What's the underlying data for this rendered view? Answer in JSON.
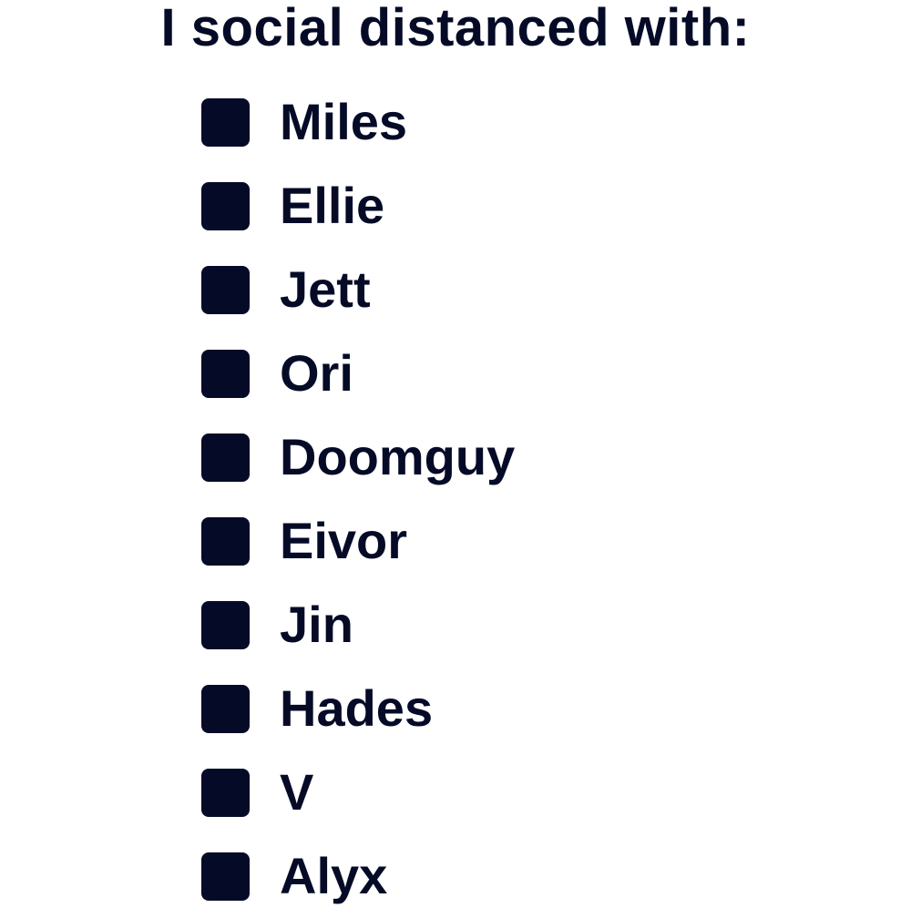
{
  "title": "I social distanced with:",
  "box_color": "#050b27",
  "items": [
    {
      "label": "Miles"
    },
    {
      "label": "Ellie"
    },
    {
      "label": "Jett"
    },
    {
      "label": "Ori"
    },
    {
      "label": "Doomguy"
    },
    {
      "label": "Eivor"
    },
    {
      "label": "Jin"
    },
    {
      "label": "Hades"
    },
    {
      "label": "V"
    },
    {
      "label": "Alyx"
    }
  ]
}
